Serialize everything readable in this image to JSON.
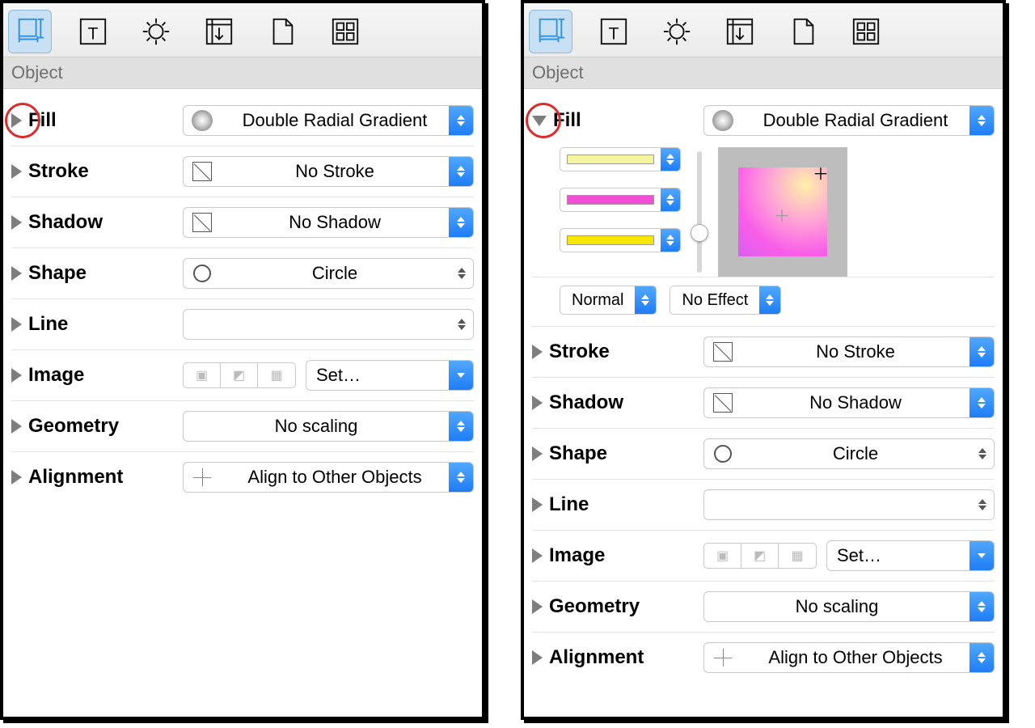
{
  "section_title": "Object",
  "toolbar": {
    "icons": [
      "object-icon",
      "text-icon",
      "gear-icon",
      "canvas-icon",
      "document-icon",
      "grid-icon"
    ],
    "active_index": 0
  },
  "rows": {
    "fill": {
      "label": "Fill",
      "value": "Double Radial Gradient"
    },
    "stroke": {
      "label": "Stroke",
      "value": "No Stroke"
    },
    "shadow": {
      "label": "Shadow",
      "value": "No Shadow"
    },
    "shape": {
      "label": "Shape",
      "value": "Circle"
    },
    "line": {
      "label": "Line",
      "value": ""
    },
    "image": {
      "label": "Image",
      "set_label": "Set…"
    },
    "geometry": {
      "label": "Geometry",
      "value": "No scaling"
    },
    "alignment": {
      "label": "Alignment",
      "value": "Align to Other Objects"
    }
  },
  "fill_expanded": {
    "colors": [
      "#f5f5a0",
      "#f04fd6",
      "#f7e600"
    ],
    "blend_mode": "Normal",
    "effect": "No Effect"
  }
}
